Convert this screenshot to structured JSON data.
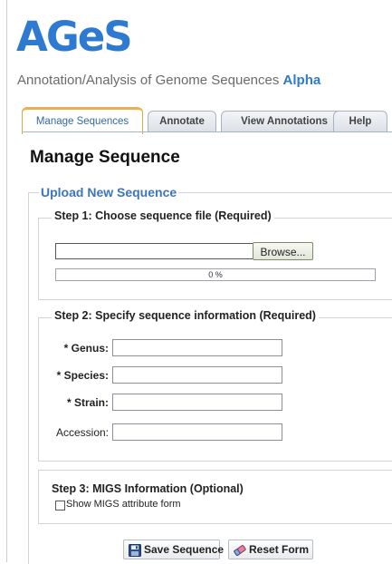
{
  "app": {
    "logo": "AGeS",
    "subtitle": "Annotation/Analysis of Genome Sequences",
    "badge": "Alpha"
  },
  "tabs": [
    {
      "label": "Manage Sequences",
      "active": true
    },
    {
      "label": "Annotate",
      "active": false
    },
    {
      "label": "View Annotations",
      "active": false
    },
    {
      "label": "Help",
      "active": false
    }
  ],
  "page": {
    "title": "Manage Sequence"
  },
  "upload": {
    "legend": "Upload New Sequence",
    "step1": {
      "legend": "Step 1: Choose sequence file (Required)",
      "file_value": "",
      "browse_label": "Browse...",
      "progress_text": "0 %",
      "progress_fraction": 0
    },
    "step2": {
      "legend": "Step 2: Specify sequence information (Required)",
      "genus_label": "* Genus:",
      "species_label": "* Species:",
      "strain_label": "* Strain:",
      "accession_label": "Accession:",
      "genus_value": "",
      "species_value": "",
      "strain_value": "",
      "accession_value": ""
    },
    "step3": {
      "legend": "Step 3: MIGS Information (Optional)",
      "checkbox_label": "Show MIGS attribute form",
      "checked": false
    }
  },
  "actions": {
    "save_label": "Save Sequence",
    "reset_label": "Reset Form"
  },
  "colors": {
    "brand": "#2f7ad1",
    "active_tab_border": "#eab24c",
    "legend_blue": "#3b74c3"
  },
  "icons": {
    "save": "floppy-disk-icon",
    "reset": "eraser-icon"
  }
}
